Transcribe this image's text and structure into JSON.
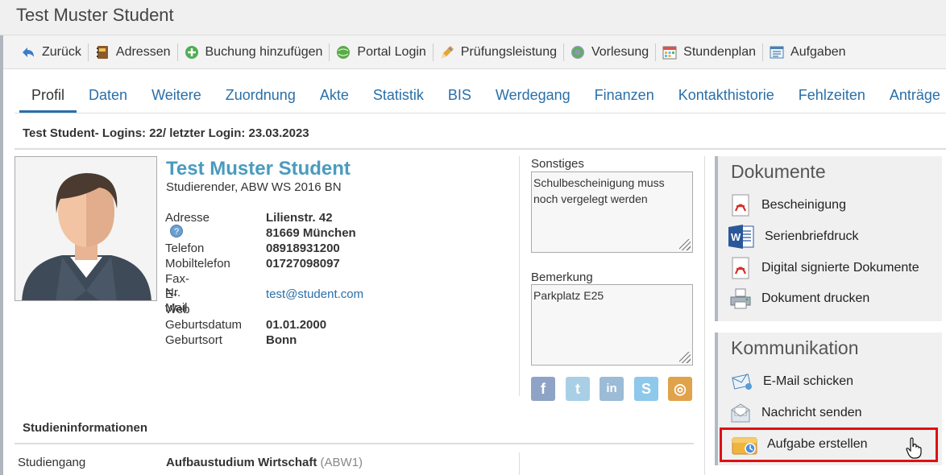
{
  "window": {
    "title": "Test Muster Student"
  },
  "toolbar": {
    "items": [
      {
        "label": "Zurück",
        "icon": "back-arrow-icon"
      },
      {
        "label": "Adressen",
        "icon": "address-book-icon"
      },
      {
        "label": "Buchung hinzufügen",
        "icon": "add-circle-icon"
      },
      {
        "label": "Portal Login",
        "icon": "globe-icon"
      },
      {
        "label": "Prüfungsleistung",
        "icon": "exam-pencil-icon"
      },
      {
        "label": "Vorlesung",
        "icon": "lecture-refresh-icon"
      },
      {
        "label": "Stundenplan",
        "icon": "calendar-icon"
      },
      {
        "label": "Aufgaben",
        "icon": "task-list-icon"
      }
    ]
  },
  "tabs": [
    "Profil",
    "Daten",
    "Weitere",
    "Zuordnung",
    "Akte",
    "Statistik",
    "BIS",
    "Werdegang",
    "Finanzen",
    "Kontakthistorie",
    "Fehlzeiten",
    "Anträge"
  ],
  "active_tab": "Profil",
  "login_info": "Test Student- Logins: 22/ letzter Login: 23.03.2023",
  "student": {
    "name": "Test Muster Student",
    "subtitle": "Studierender, ABW WS 2016 BN",
    "fields": {
      "adresse_label": "Adresse",
      "adresse_line1": "Lilienstr. 42",
      "adresse_line2": "81669 München",
      "telefon_label": "Telefon",
      "telefon": "08918931200",
      "mobil_label": "Mobiltelefon",
      "mobil": "01727098097",
      "fax_label": "Fax-Nr.",
      "email_label": "E-Mail",
      "email": "test@student.com",
      "web_label": "Web",
      "geburtsdatum_label": "Geburtsdatum",
      "geburtsdatum": "01.01.2000",
      "geburtsort_label": "Geburtsort",
      "geburtsort": "Bonn"
    }
  },
  "notes": {
    "sonstiges_label": "Sonstiges",
    "sonstiges_text": "Schulbescheinigung muss noch vergelegt werden",
    "bemerkung_label": "Bemerkung",
    "bemerkung_text": "Parkplatz E25"
  },
  "social": [
    "facebook-icon",
    "twitter-icon",
    "linkedin-icon",
    "skype-icon",
    "other-social-icon"
  ],
  "dokumente": {
    "title": "Dokumente",
    "items": [
      "Bescheinigung",
      "Serienbriefdruck",
      "Digital signierte Dokumente",
      "Dokument drucken"
    ]
  },
  "kommunikation": {
    "title": "Kommunikation",
    "items": [
      "E-Mail schicken",
      "Nachricht senden",
      "Aufgabe erstellen"
    ]
  },
  "studieninfo": {
    "heading": "Studieninformationen",
    "studiengang_label": "Studiengang",
    "studiengang_value": "Aufbaustudium Wirtschaft",
    "studiengang_code": "(ABW1)"
  },
  "colors": {
    "accent": "#2a6fa8",
    "name": "#4a9bbf",
    "highlight": "#dd1111"
  }
}
